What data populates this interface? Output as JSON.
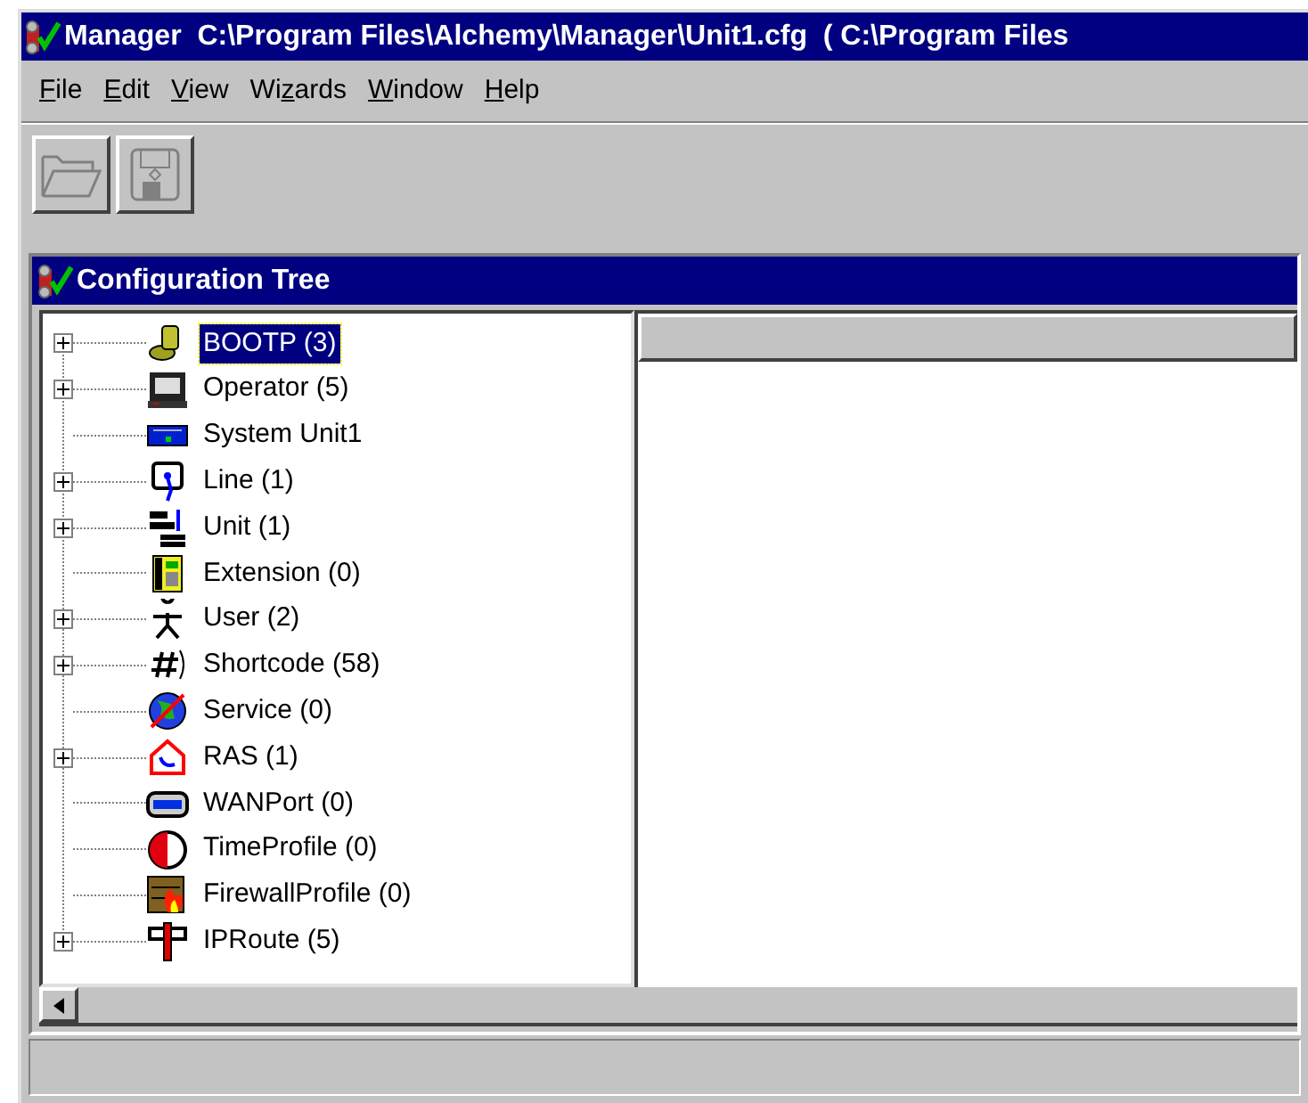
{
  "window": {
    "title": "Manager  C:\\Program Files\\Alchemy\\Manager\\Unit1.cfg  ( C:\\Program Files"
  },
  "menu": [
    {
      "key": "F",
      "rest": "ile"
    },
    {
      "key": "E",
      "rest": "dit"
    },
    {
      "key": "V",
      "rest": "iew"
    },
    {
      "lead": "Wi",
      "key": "z",
      "rest": "ards"
    },
    {
      "key": "W",
      "rest": "indow"
    },
    {
      "key": "H",
      "rest": "elp"
    }
  ],
  "toolbar": [
    {
      "kind": "open",
      "disabled": true
    },
    {
      "kind": "save",
      "disabled": true
    }
  ],
  "child_window": {
    "title": "Configuration Tree"
  },
  "tree": [
    {
      "label": "BOOTP (3)",
      "kind": "branch",
      "selected": true
    },
    {
      "label": "Operator (5)",
      "kind": "branch",
      "selected": false
    },
    {
      "label": "System Unit1",
      "kind": "leaf",
      "selected": false
    },
    {
      "label": "Line (1)",
      "kind": "branch",
      "selected": false
    },
    {
      "label": "Unit (1)",
      "kind": "branch",
      "selected": false
    },
    {
      "label": "Extension (0)",
      "kind": "leaf",
      "selected": false
    },
    {
      "label": "User (2)",
      "kind": "branch",
      "selected": false
    },
    {
      "label": "Shortcode (58)",
      "kind": "branch",
      "selected": false
    },
    {
      "label": "Service (0)",
      "kind": "leaf",
      "selected": false
    },
    {
      "label": "RAS (1)",
      "kind": "branch",
      "selected": false
    },
    {
      "label": "WANPort (0)",
      "kind": "leaf",
      "selected": false
    },
    {
      "label": "TimeProfile (0)",
      "kind": "leaf",
      "selected": false
    },
    {
      "label": "FirewallProfile (0)",
      "kind": "leaf",
      "selected": false
    },
    {
      "label": "IPRoute (5)",
      "kind": "branch",
      "selected": false
    }
  ]
}
